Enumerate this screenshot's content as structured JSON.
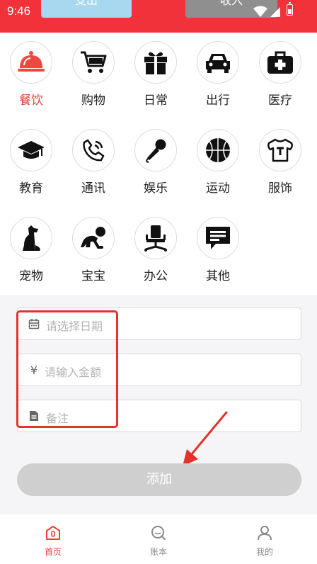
{
  "status_bar": {
    "time": "9:46"
  },
  "header": {
    "tab_expense": "支出",
    "tab_income": "收入"
  },
  "categories": [
    {
      "label": "餐饮",
      "icon": "cloche-icon",
      "active": true
    },
    {
      "label": "购物",
      "icon": "cart-icon"
    },
    {
      "label": "日常",
      "icon": "gift-icon"
    },
    {
      "label": "出行",
      "icon": "car-icon"
    },
    {
      "label": "医疗",
      "icon": "medkit-icon"
    },
    {
      "label": "教育",
      "icon": "graduation-cap-icon"
    },
    {
      "label": "通讯",
      "icon": "phone-icon"
    },
    {
      "label": "娱乐",
      "icon": "microphone-icon"
    },
    {
      "label": "运动",
      "icon": "basketball-icon"
    },
    {
      "label": "服饰",
      "icon": "tshirt-icon"
    },
    {
      "label": "宠物",
      "icon": "dog-icon"
    },
    {
      "label": "宝宝",
      "icon": "baby-icon"
    },
    {
      "label": "办公",
      "icon": "office-chair-icon"
    },
    {
      "label": "其他",
      "icon": "message-icon"
    }
  ],
  "form": {
    "date_placeholder": "请选择日期",
    "amount_icon": "¥",
    "amount_placeholder": "请输入金额",
    "note_placeholder": "备注",
    "add_label": "添加"
  },
  "nav": [
    {
      "label": "首页",
      "icon": "home-icon",
      "active": true
    },
    {
      "label": "账本",
      "icon": "search-icon"
    },
    {
      "label": "我的",
      "icon": "user-icon"
    }
  ],
  "colors": {
    "brand": "#f2323a",
    "accent": "#e8413b",
    "disabled": "#cfcfcf",
    "annotation": "#e3332c"
  }
}
